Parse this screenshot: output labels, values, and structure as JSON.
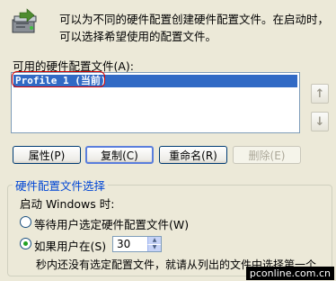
{
  "description": "可以为不同的硬件配置创建硬件配置文件。在启动时，可以选择希望使用的配置文件。",
  "list_label": "可用的硬件配置文件(A):",
  "profiles": [
    {
      "label": "Profile 1 (当前)",
      "selected": true
    }
  ],
  "move_up_label": "↑",
  "move_down_label": "↓",
  "buttons": {
    "properties": "属性(P)",
    "copy": "复制(C)",
    "rename": "重命名(R)",
    "delete": "删除(E)"
  },
  "selection_group": {
    "title": "硬件配置文件选择",
    "startup_label": "启动 Windows 时:",
    "wait_option": "等待用户选定硬件配置文件(W)",
    "timeout_option": "如果用户在(S)",
    "timeout_value": "30",
    "timeout_suffix": "秒内还没有选定配置文件，就请从列出的文件中选择第一个"
  },
  "watermark": "pconline.com.cn"
}
